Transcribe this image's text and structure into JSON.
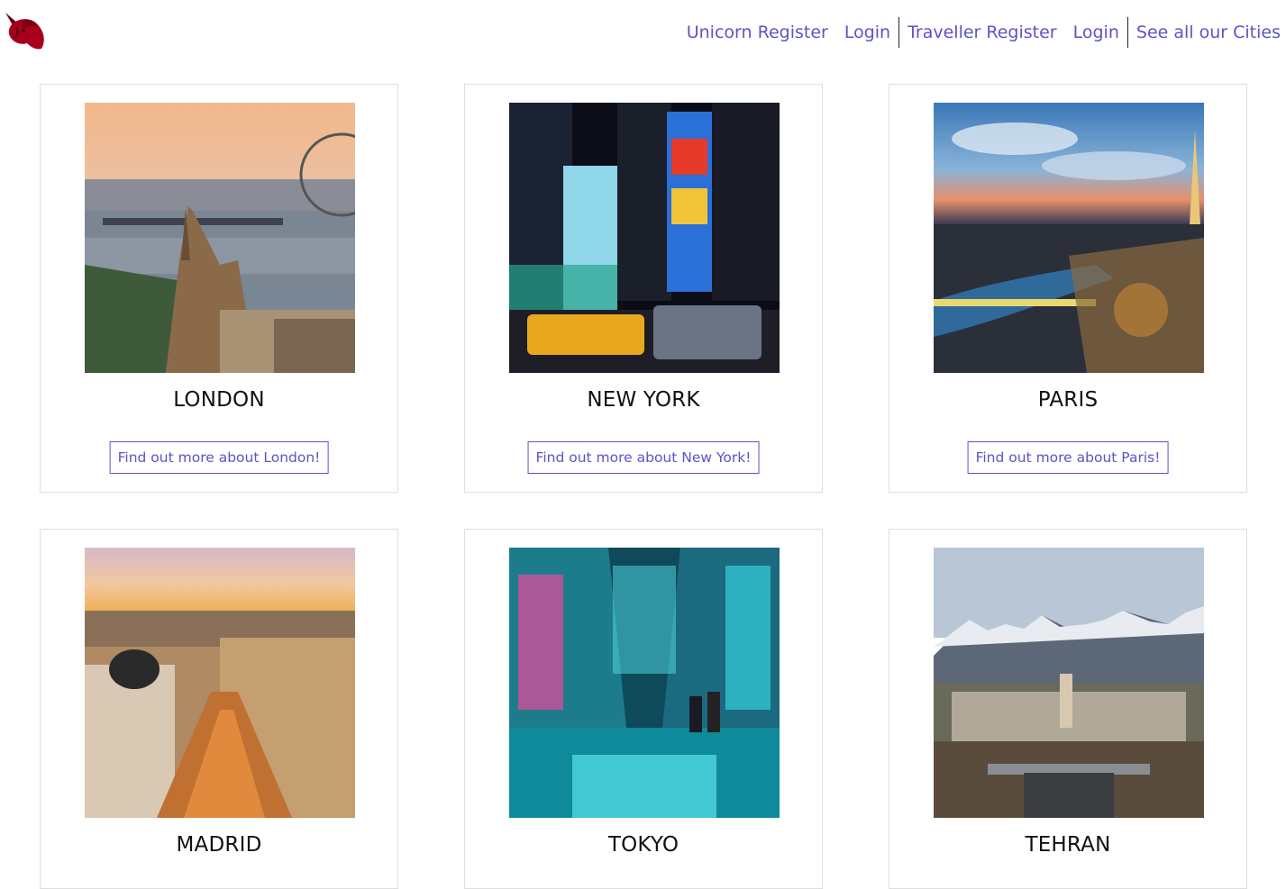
{
  "nav": {
    "logo": "unicorn-logo",
    "unicorn_register": "Unicorn Register",
    "login_1": "Login",
    "traveller_register": "Traveller Register",
    "login_2": "Login",
    "all_cities": "See all our Cities",
    "link_color": "#5a55c7"
  },
  "cities": [
    {
      "name": "LONDON",
      "button": "Find out more about London!"
    },
    {
      "name": "NEW YORK",
      "button": "Find out more about New York!"
    },
    {
      "name": "PARIS",
      "button": "Find out more about Paris!"
    },
    {
      "name": "MADRID"
    },
    {
      "name": "TOKYO"
    },
    {
      "name": "TEHRAN"
    }
  ]
}
